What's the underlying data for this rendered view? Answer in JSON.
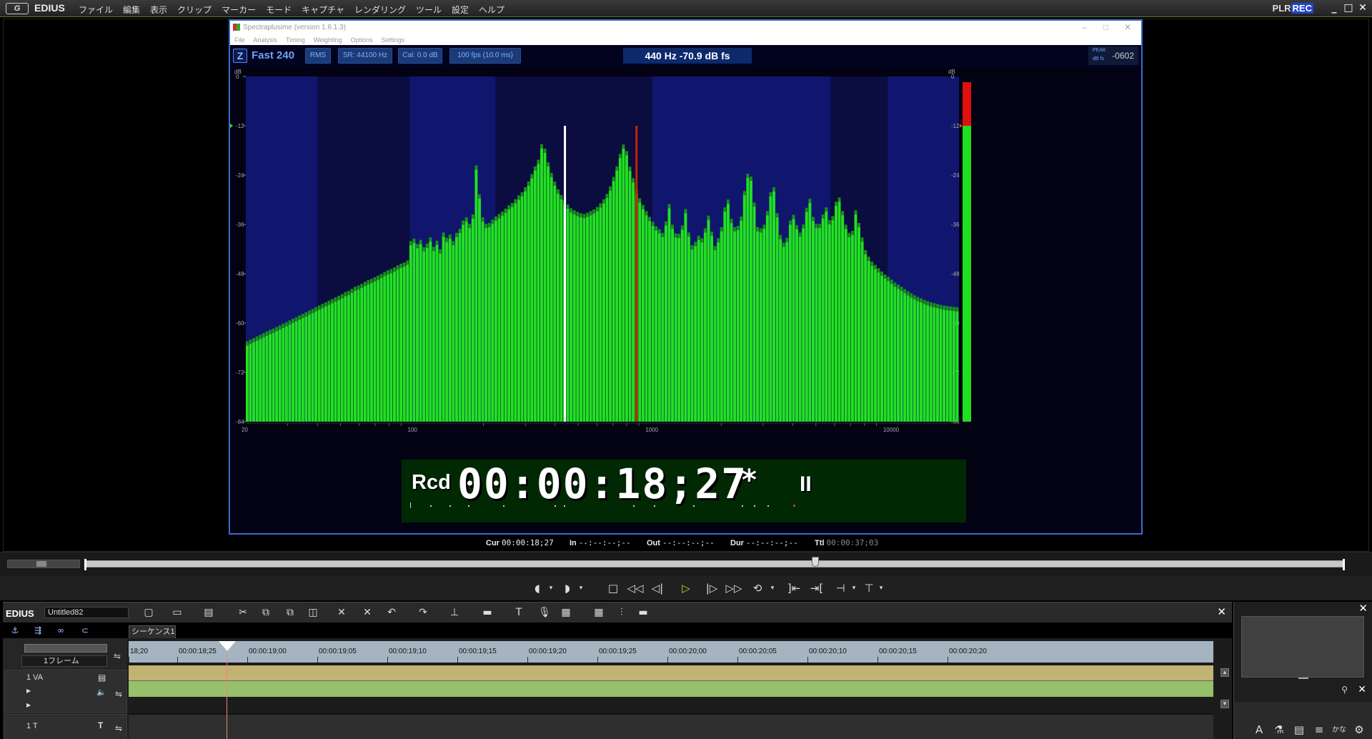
{
  "app": {
    "logo_text": "G",
    "name": "EDIUS",
    "menu": [
      "ファイル",
      "編集",
      "表示",
      "クリップ",
      "マーカー",
      "モード",
      "キャプチャ",
      "レンダリング",
      "ツール",
      "設定",
      "ヘルプ"
    ],
    "plr": "PLR",
    "rec": "REC"
  },
  "spectrum_window": {
    "title": "Spectraplusime (version 1.6.1.3)",
    "menu": [
      "File",
      "Analysis",
      "Timing",
      "Weighting",
      "Options",
      "Settings"
    ],
    "zoom": "Z",
    "mode": "Fast 240",
    "buttons": [
      "RMS",
      "SR: 44100 Hz",
      "Cal: 0.0 dB",
      "100 fps (10.0 ms)"
    ],
    "readout": "440 Hz  -70.9 dB fs",
    "peak_label_1": "PEAK",
    "peak_label_2": "dB fs",
    "peak_value": "-0602",
    "db_unit": "dB",
    "db_ticks": [
      "0",
      "-12",
      "-24",
      "-36",
      "-48",
      "-60",
      "-72",
      "-84"
    ],
    "freq_labels": [
      "20",
      "100",
      "1000",
      "10000"
    ],
    "colors": {
      "background": "#020212",
      "bars": "#22e022",
      "bars_dark": "#1a8f1a",
      "band_blue": "#10166e",
      "band_dark": "#0b0c40",
      "meter_red": "#e01010"
    }
  },
  "chart_data": {
    "type": "bar",
    "xscale": "log",
    "xlim": [
      20,
      20000
    ],
    "ylim": [
      -84,
      0
    ],
    "ylabel": "dB",
    "markers": [
      {
        "freq": 440,
        "color": "#ffffff"
      },
      {
        "freq": 880,
        "color": "#cc2200"
      }
    ],
    "level_meter": {
      "peak_db": -12,
      "level_db": -12
    },
    "series": [
      {
        "values": [
          -65.5,
          -65.1,
          -64.7,
          -64.3,
          -63.9,
          -63.5,
          -63.1,
          -62.7,
          -62.4,
          -62.0,
          -61.6,
          -61.2,
          -60.8,
          -60.4,
          -60.0,
          -59.6,
          -59.2,
          -58.8,
          -58.4,
          -58.0,
          -57.6,
          -57.2,
          -56.8,
          -56.4,
          -56.0,
          -55.6,
          -55.2,
          -54.8,
          -54.4,
          -54.0,
          -53.5,
          -53.2,
          -52.7,
          -52.2,
          -51.9,
          -51.5,
          -51.0,
          -50.6,
          -50.3,
          -49.9,
          -49.5,
          -49.1,
          -48.6,
          -48.2,
          -47.9,
          -47.5,
          -47.0,
          -46.6,
          -46.3,
          -45.8,
          -41.1,
          -40.5,
          -41.8,
          -40.8,
          -42.6,
          -41.7,
          -40.2,
          -42.5,
          -41.0,
          -43.1,
          -39.0,
          -40.3,
          -39.5,
          -41.1,
          -39.1,
          -38.1,
          -36.1,
          -35.3,
          -36.9,
          -34.6,
          -22.7,
          -29.7,
          -35.3,
          -36.9,
          -36.7,
          -35.9,
          -35.1,
          -34.5,
          -33.9,
          -33.2,
          -32.4,
          -31.8,
          -30.9,
          -30.0,
          -29.2,
          -28.0,
          -26.6,
          -24.8,
          -22.9,
          -21.3,
          -17.5,
          -18.6,
          -21.9,
          -24.5,
          -26.6,
          -28.5,
          -29.9,
          -31.2,
          -32.2,
          -33.1,
          -33.6,
          -34.0,
          -34.3,
          -34.5,
          -34.2,
          -33.8,
          -33.4,
          -32.8,
          -31.9,
          -30.9,
          -29.6,
          -27.8,
          -25.5,
          -22.9,
          -19.9,
          -17.6,
          -19.2,
          -23.0,
          -25.8,
          -28.5,
          -30.7,
          -32.3,
          -33.8,
          -35.2,
          -36.4,
          -37.5,
          -38.2,
          -39.1,
          -36.3,
          -32.1,
          -37.1,
          -39.2,
          -39.3,
          -37.3,
          -33.3,
          -39.0,
          -42.1,
          -41.3,
          -39.8,
          -40.4,
          -38.0,
          -34.9,
          -38.8,
          -42.3,
          -40.4,
          -37.7,
          -32.9,
          -31.0,
          -35.7,
          -37.7,
          -37.4,
          -35.1,
          -28.9,
          -24.7,
          -25.4,
          -31.7,
          -37.7,
          -38.0,
          -37.1,
          -33.8,
          -29.2,
          -28.0,
          -34.3,
          -39.6,
          -41.5,
          -40.3,
          -36.1,
          -34.7,
          -37.2,
          -39.0,
          -37.0,
          -33.0,
          -30.8,
          -35.2,
          -36.9,
          -36.9,
          -34.6,
          -32.9,
          -36.0,
          -35.0,
          -31.5,
          -30.5,
          -33.8,
          -37.1,
          -39.1,
          -38.6,
          -33.6,
          -36.7,
          -40.2,
          -43.3,
          -44.9,
          -46.1,
          -46.9,
          -47.7,
          -48.5,
          -49.2,
          -49.8,
          -50.5,
          -51.2,
          -51.7,
          -52.2,
          -52.8,
          -53.3,
          -53.8,
          -54.3,
          -54.7,
          -55.0,
          -55.4,
          -55.7,
          -56.0,
          -56.2,
          -56.4,
          -56.6,
          -56.8,
          -56.9,
          -57.0,
          -57.1,
          -57.2
        ]
      }
    ]
  },
  "timecode_overlay": {
    "prefix": "Rcd",
    "value": "00:00:18;27",
    "star": "*",
    "pause": "II"
  },
  "status": {
    "cur_label": "Cur",
    "cur": "00:00:18;27",
    "in_label": "In",
    "in": "--:--:--;--",
    "out_label": "Out",
    "out": "--:--:--;--",
    "dur_label": "Dur",
    "dur": "--:--:--;--",
    "ttl_label": "Ttl",
    "ttl": "00:00:37;03"
  },
  "scrub": {
    "position_fraction": 0.58
  },
  "timeline": {
    "app": "EDIUS",
    "project": "Untitled82",
    "sequence_tab": "シーケンス1",
    "frame_step": "1フレーム",
    "ruler_labels": [
      "18;20",
      "00:00:18;25",
      "00:00:19;00",
      "00:00:19;05",
      "00:00:19;10",
      "00:00:19;15",
      "00:00:19;20",
      "00:00:19;25",
      "00:00:20;00",
      "00:00:20;05",
      "00:00:20;10",
      "00:00:20;15",
      "00:00:20;20"
    ],
    "tracks": [
      {
        "name": "1 VA"
      },
      {
        "name": "1 T"
      }
    ]
  }
}
